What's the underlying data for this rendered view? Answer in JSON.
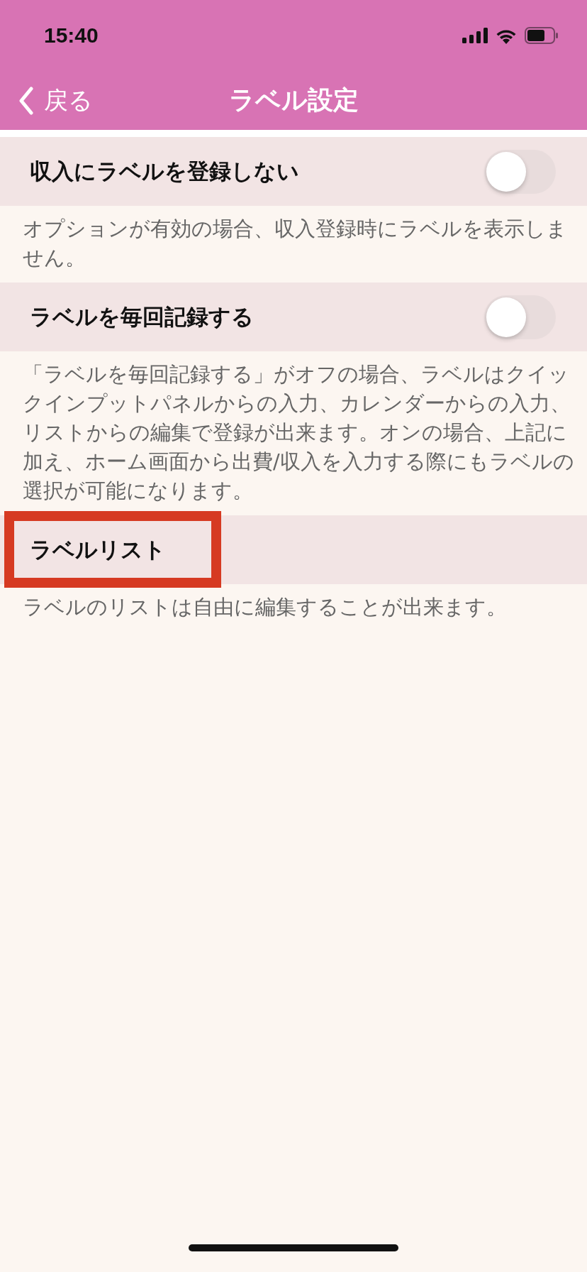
{
  "status_bar": {
    "time": "15:40"
  },
  "nav": {
    "back": "戻る",
    "title": "ラベル設定"
  },
  "sections": [
    {
      "kind": "toggle",
      "label": "収入にラベルを登録しない",
      "on": false,
      "highlighted": false,
      "description": "オプションが有効の場合、収入登録時にラベルを表示しません。"
    },
    {
      "kind": "toggle",
      "label": "ラベルを毎回記録する",
      "on": false,
      "highlighted": false,
      "description": "「ラベルを毎回記録する」がオフの場合、ラベルはクイックインプットパネルからの入力、カレンダーからの入力、リストからの編集で登録が出来ます。オンの場合、上記に加え、ホーム画面から出費/収入を入力する際にもラベルの選択が可能になります。"
    },
    {
      "kind": "link",
      "label": "ラベルリスト",
      "highlighted": true,
      "description": "ラベルのリストは自由に編集することが出来ます。"
    }
  ]
}
